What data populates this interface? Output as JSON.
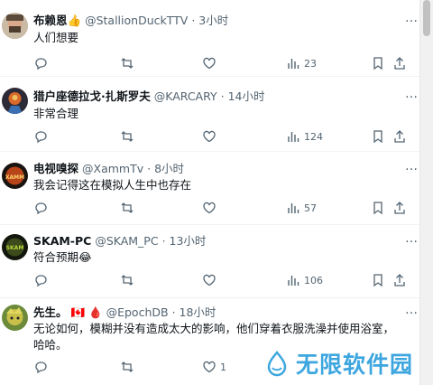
{
  "tweets": [
    {
      "name": "布赖恩",
      "badge": "👍",
      "handle": "@StallionDuckTTV",
      "time": "3小时",
      "text": "人们想要",
      "views": "23"
    },
    {
      "name": "猎户座德拉戈·扎斯罗夫",
      "handle": "@KARCARY",
      "time": "14小时",
      "text": "非常合理",
      "views": "124"
    },
    {
      "name": "电视嗅探",
      "handle": "@XammTv",
      "time": "8小时",
      "text": "我会记得这在模拟人生中也存在",
      "views": "57"
    },
    {
      "name": "SKAM-PC",
      "handle": "@SKAM_PC",
      "time": "13小时",
      "text": "符合预期😂",
      "views": "106"
    },
    {
      "name": "先生。",
      "badge": "🇨🇦 🩸",
      "handle": "@EpochDB",
      "time": "18小时",
      "text": "无论如何，模糊并没有造成太大的影响，他们穿着衣服洗澡并使用浴室，哈哈。",
      "likes": "1"
    }
  ],
  "separator": "·",
  "more_icon": "…",
  "watermark": "无限软件园",
  "colors": {
    "text": "#0f1419",
    "muted": "#536471",
    "divider": "#eff3f4",
    "watermark": "#3da6df"
  }
}
